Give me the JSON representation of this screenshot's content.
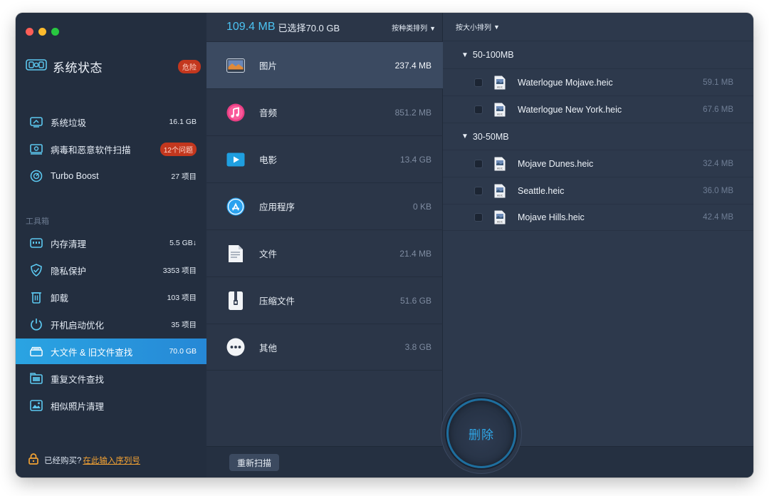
{
  "sidebar": {
    "status_title": "系统状态",
    "status_badge": "危险",
    "items": [
      {
        "label": "系统垃圾",
        "count": "16.1 GB",
        "icon": "trash-icon"
      },
      {
        "label": "病毒和恶意软件扫描",
        "count": "12个问题",
        "icon": "virus-scan-icon"
      },
      {
        "label": "Turbo Boost",
        "count": "27 项目",
        "icon": "turbo-boost-icon"
      }
    ],
    "tools_section": "工具箱",
    "tools": [
      {
        "label": "内存清理",
        "count": "5.5 GB↓",
        "icon": "memory-icon"
      },
      {
        "label": "隐私保护",
        "count": "3353 项目",
        "icon": "privacy-shield-icon"
      },
      {
        "label": "卸载",
        "count": "103 项目",
        "icon": "uninstall-icon"
      },
      {
        "label": "开机启动优化",
        "count": "35 项目",
        "icon": "startup-power-icon"
      },
      {
        "label": "大文件 & 旧文件查找",
        "count": "70.0 GB",
        "icon": "large-files-icon"
      },
      {
        "label": "重复文件查找",
        "count": "",
        "icon": "duplicate-files-icon"
      },
      {
        "label": "相似照片清理",
        "count": "",
        "icon": "similar-photos-icon"
      }
    ],
    "footer_text": "已经购买?",
    "footer_link": "在此输入序列号"
  },
  "middle": {
    "total_size": "109.4 MB",
    "selected_label": "已选择70.0 GB",
    "sort_label": "按种类排列",
    "categories": [
      {
        "label": "图片",
        "size": "237.4 MB",
        "icon": "photos-icon"
      },
      {
        "label": "音频",
        "size": "851.2 MB",
        "icon": "music-icon"
      },
      {
        "label": "电影",
        "size": "13.4 GB",
        "icon": "movie-icon"
      },
      {
        "label": "应用程序",
        "size": "0 KB",
        "icon": "app-store-icon"
      },
      {
        "label": "文件",
        "size": "21.4 MB",
        "icon": "document-icon"
      },
      {
        "label": "压缩文件",
        "size": "51.6 GB",
        "icon": "archive-icon"
      },
      {
        "label": "其他",
        "size": "3.8 GB",
        "icon": "more-icon"
      }
    ],
    "rescan_label": "重新扫描"
  },
  "right": {
    "sort_label": "按大小排列",
    "groups": [
      {
        "label": "50-100MB",
        "files": [
          {
            "name": "Waterlogue Mojave.heic",
            "size": "59.1 MB"
          },
          {
            "name": "Waterlogue New York.heic",
            "size": "67.6 MB"
          }
        ]
      },
      {
        "label": "30-50MB",
        "files": [
          {
            "name": "Mojave Dunes.heic",
            "size": "32.4 MB"
          },
          {
            "name": "Seattle.heic",
            "size": "36.0 MB"
          },
          {
            "name": "Mojave Hills.heic",
            "size": "42.4 MB"
          }
        ]
      }
    ]
  },
  "delete_label": "删除",
  "colors": {
    "accent": "#2aa4e2",
    "danger": "#c3371e",
    "warning": "#f3a233"
  }
}
